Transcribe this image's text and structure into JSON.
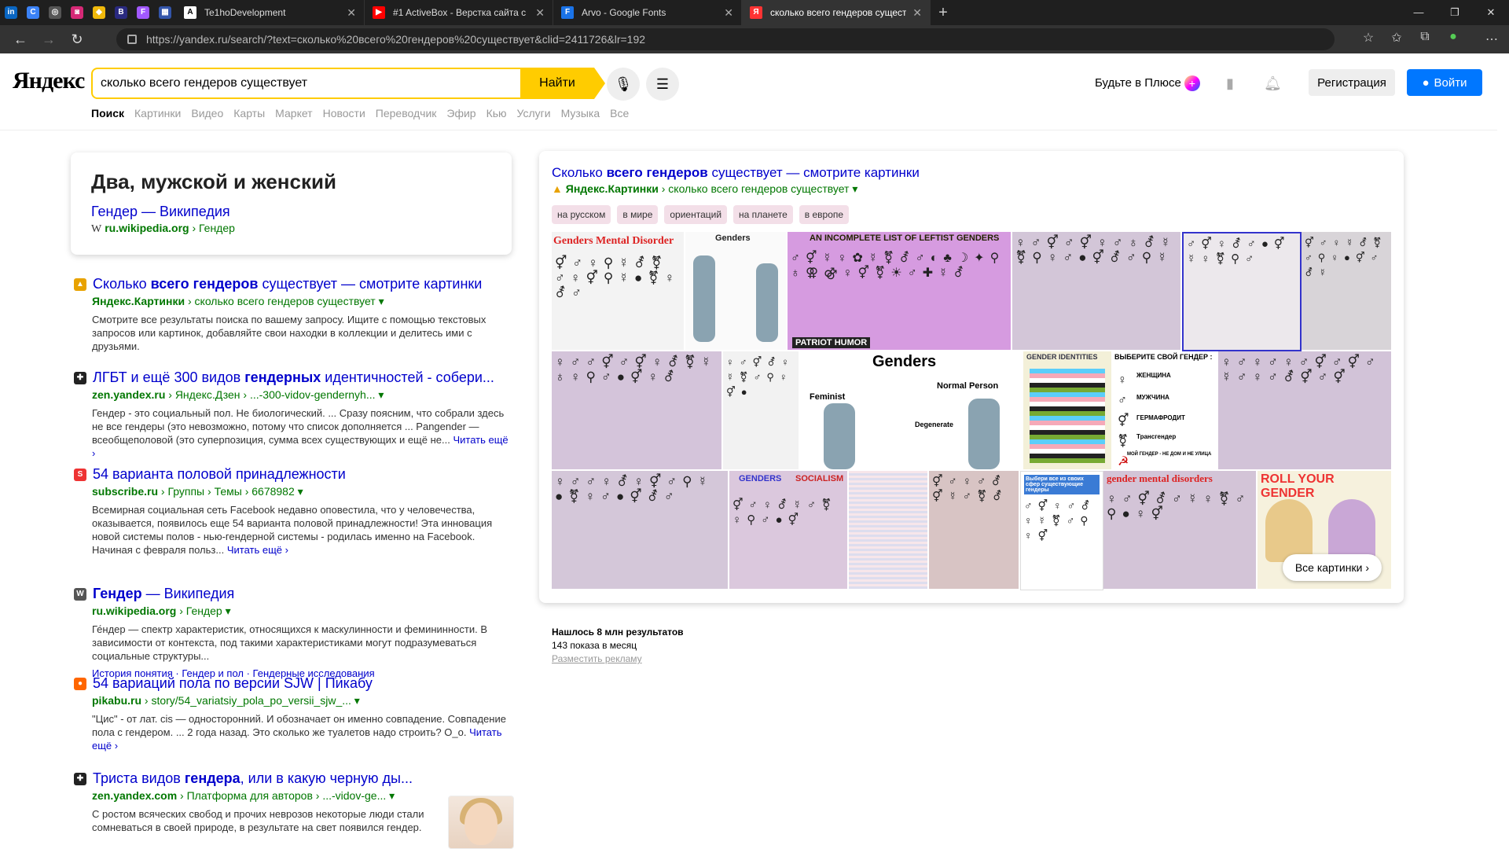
{
  "browser": {
    "pinned": [
      {
        "name": "linkedin-icon",
        "glyph": "in",
        "color": "#0a66c2"
      },
      {
        "name": "c-icon",
        "glyph": "C",
        "color": "#3b82f6"
      },
      {
        "name": "globe-icon",
        "glyph": "◎",
        "color": "#555"
      },
      {
        "name": "instagram-icon",
        "glyph": "◙",
        "color": "#d62976"
      },
      {
        "name": "binance-icon",
        "glyph": "◆",
        "color": "#f0b90b"
      },
      {
        "name": "bots-icon",
        "glyph": "B",
        "color": "#2a2a80"
      },
      {
        "name": "figma-icon",
        "glyph": "F",
        "color": "#a259ff"
      },
      {
        "name": "tile-icon",
        "glyph": "▦",
        "color": "#3355aa"
      }
    ],
    "tabs": [
      {
        "title": "Te1hoDevelopment",
        "fav": "A",
        "color": "#fff",
        "active": false
      },
      {
        "title": "#1 ActiveBox - Верстка сайта с н",
        "fav": "▶",
        "color": "#f00",
        "active": false
      },
      {
        "title": "Arvo - Google Fonts",
        "fav": "F",
        "color": "#1a73e8",
        "active": false
      },
      {
        "title": "сколько всего гендеров сущест",
        "fav": "Я",
        "color": "#f33",
        "active": true
      }
    ],
    "url": "https://yandex.ru/search/?text=сколько%20всего%20гендеров%20существует&clid=2411726&lr=192"
  },
  "header": {
    "logo_main": "Яндекс",
    "query": "сколько всего гендеров существует",
    "search_button": "Найти",
    "plus_label": "Будьте в Плюсе",
    "register_button": "Регистрация",
    "login_button": "Войти"
  },
  "nav": [
    "Поиск",
    "Картинки",
    "Видео",
    "Карты",
    "Маркет",
    "Новости",
    "Переводчик",
    "Эфир",
    "Кью",
    "Услуги",
    "Музыка",
    "Все"
  ],
  "wizard": {
    "answer": "Два, мужской и женский",
    "link_title": "Гендер — Википедия",
    "source": "ru.wikipedia.org",
    "crumb": " › Гендер"
  },
  "results": [
    {
      "title_pre": "Сколько ",
      "title_b": "всего гендеров",
      "title_post": " существует — смотрите картинки",
      "site": "Яндекс.Картинки",
      "path": " › сколько всего гендеров существует ▾",
      "text": "Смотрите все результаты поиска по вашему запросу. Ищите с помощью текстовых запросов или картинок, добавляйте свои находки в коллекции и делитесь ими с друзьями.",
      "more": "",
      "icon": "▲",
      "icolor": "#e8a200"
    },
    {
      "title_pre": "ЛГБТ и ещё 300 видов ",
      "title_b": "гендерных",
      "title_post": " идентичностей - собери...",
      "site": "zen.yandex.ru",
      "path": " › Яндекс.Дзен › ...-300-vidov-gendernyh... ▾",
      "text": "Гендер - это социальный пол. Не биологический. ... Сразу поясним, что собрали здесь не все гендеры (это невозможно, потому что список дополняется ... Pangender — всеобщеполовой (это суперпозиция, сумма всех существующих и ещё не...",
      "more": "Читать ещё ›",
      "icon": "✚",
      "icolor": "#222"
    },
    {
      "title_pre": "54 варианта половой принадлежности",
      "title_b": "",
      "title_post": "",
      "site": "subscribe.ru",
      "path": " › Группы › Темы › 6678982 ▾",
      "text": "Всемирная социальная сеть Facebook недавно оповестила, что у человечества, оказывается, появилось еще 54 варианта половой принадлежности! Эта инновация новой системы полов - нью-гендерной системы - родилась именно на Facebook. Начиная с февраля польз...",
      "more": "Читать ещё ›",
      "icon": "S",
      "icolor": "#e33"
    },
    {
      "title_pre": "",
      "title_b": "Гендер",
      "title_post": " — Википедия",
      "site": "ru.wikipedia.org",
      "path": " › Гендер ▾",
      "text": "Ге́ндер — спектр характеристик, относящихся к маскулинности и фемининности. В зависимости от контекста, под такими характеристиками могут подразумеваться социальные структуры...",
      "more": "",
      "links": "История понятия · Гендер и пол · Гендерные исследования",
      "icon": "W",
      "icolor": "#555"
    },
    {
      "title_pre": "54 вариаций пола по версии SJW | Пикабу",
      "title_b": "",
      "title_post": "",
      "site": "pikabu.ru",
      "path": " › story/54_variatsiy_pola_po_versii_sjw_... ▾",
      "text": "\"Цис\" - от лат. cis — односторонний. И обозначает он именно совпадение. Совпадение пола с гендером. ... 2 года назад. Это сколько же туалетов надо строить? O_o.",
      "more": "Читать ещё ›",
      "icon": "●",
      "icolor": "#f60"
    },
    {
      "title_pre": "Триста видов ",
      "title_b": "гендера",
      "title_post": ", или в какую черную ды...",
      "site": "zen.yandex.com",
      "path": " › Платформа для авторов › ...-vidov-ge... ▾",
      "text": "С ростом всяческих свобод и прочих неврозов некоторые люди стали сомневаться в своей природе, в результате на свет появился гендер.",
      "more": "",
      "icon": "✚",
      "icolor": "#222"
    }
  ],
  "images": {
    "title_pre": "Сколько ",
    "title_b": "всего гендеров",
    "title_post": " существует — смотрите картинки",
    "site": "Яндекс.Картинки",
    "path": " › сколько всего гендеров существует ▾",
    "chips": [
      "на русском",
      "в мире",
      "ориентаций",
      "на планете",
      "в европе"
    ],
    "labels": {
      "mental": "Genders  Mental Disorder",
      "genders_small": "Genders",
      "leftist": "AN INCOMPLETE LIST OF LEFTIST GENDERS",
      "patriot": "PATRIOT HUMOR",
      "genders_big": "Genders",
      "feminist": "Feminist",
      "normal": "Normal Person",
      "degenerate": "Degenerate",
      "identities": "GENDER IDENTITIES",
      "choose": "ВЫБЕРИТЕ СВОЙ ГЕНДЕР :",
      "woman": "ЖЕНЩИНА",
      "man": "МУЖЧИНА",
      "herm": "ГЕРМАФРОДИТ",
      "trans": "Трансгендер",
      "my": "МОЙ ГЕНДЕР - НЕ ДОМ И НЕ УЛИЦА",
      "genders_blue": "GENDERS",
      "socialism": "SOCIALISM",
      "choose2": "Выбери все из своих сфер существующие гендеры",
      "gender_md": "gender    mental disorders",
      "roll": "ROLL YOUR GENDER"
    },
    "all_button": "Все картинки"
  },
  "stats": {
    "found": "Нашлось 8 млн результатов",
    "shows": "143 показа в месяц",
    "ad": "Разместить рекламу"
  },
  "colors": {
    "accent_yellow": "#ffcc00",
    "link": "#0000cc",
    "green": "#007700",
    "login_blue": "#0077ff"
  }
}
